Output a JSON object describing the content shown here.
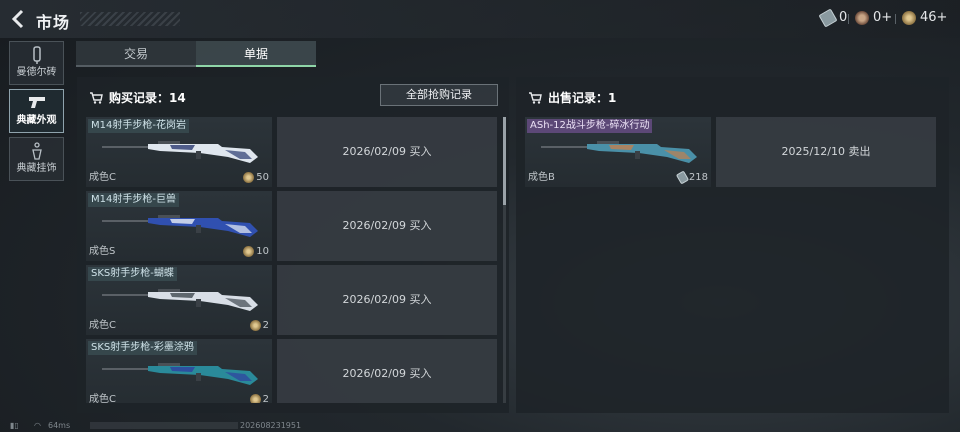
{
  "header": {
    "back_icon": "chevron-left-icon",
    "title": "市场",
    "currencies": [
      {
        "icon": "ticket-icon",
        "value": "0"
      },
      {
        "icon": "skull-coin-icon",
        "value": "0+"
      },
      {
        "icon": "coin-icon",
        "value": "46+"
      }
    ]
  },
  "sidebar": {
    "items": [
      {
        "label": "曼德尔砖",
        "icon": "brick-icon",
        "active": false
      },
      {
        "label": "典藏外观",
        "icon": "pistol-icon",
        "active": true
      },
      {
        "label": "典藏挂饰",
        "icon": "charm-icon",
        "active": false
      }
    ]
  },
  "tabs": [
    {
      "label": "交易",
      "active": false
    },
    {
      "label": "单据",
      "active": true
    }
  ],
  "purchase": {
    "header": "购买记录：14",
    "all_button": "全部抢购记录",
    "records": [
      {
        "name": "M14射手步枪-花岗岩",
        "grade": "成色C",
        "price": "50",
        "info": "2026/02/09 买入",
        "gun_color": "#dfe6ee",
        "accent": "#2a3a70"
      },
      {
        "name": "M14射手步枪-巨兽",
        "grade": "成色S",
        "price": "10",
        "info": "2026/02/09 买入",
        "gun_color": "#3050b0",
        "accent": "#e8eef6"
      },
      {
        "name": "SKS射手步枪-蝴蝶",
        "grade": "成色C",
        "price": "2",
        "info": "2026/02/09 买入",
        "gun_color": "#d8dee6",
        "accent": "#404850"
      },
      {
        "name": "SKS射手步枪-彩墨涂鸦",
        "grade": "成色C",
        "price": "2",
        "info": "2026/02/09 买入",
        "gun_color": "#2a8a9a",
        "accent": "#3040a0"
      }
    ]
  },
  "sale": {
    "header": "出售记录：1",
    "records": [
      {
        "name": "ASh-12战斗步枪-碎冰行动",
        "grade": "成色B",
        "price": "218",
        "info": "2025/12/10 卖出",
        "gun_color": "#4a90a8",
        "accent": "#c08050"
      }
    ]
  },
  "status": {
    "ping": "64ms",
    "build": "202608231951"
  },
  "colors": {
    "tab_active_underline": "#8fd6a8",
    "sidebar_active_border": "#8fa3ad"
  }
}
